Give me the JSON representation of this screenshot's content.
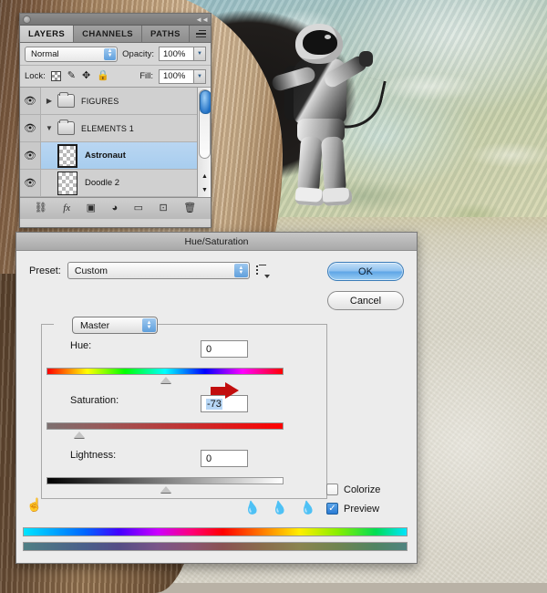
{
  "layers_panel": {
    "title_dot": "collapse-dot",
    "tabs": [
      {
        "label": "LAYERS",
        "active": true
      },
      {
        "label": "CHANNELS",
        "active": false
      },
      {
        "label": "PATHS",
        "active": false
      }
    ],
    "blend_mode": "Normal",
    "opacity_label": "Opacity:",
    "opacity_value": "100%",
    "lock_label": "Lock:",
    "lock_icons": [
      "transparency-lock-icon",
      "paint-lock-icon",
      "move-lock-icon",
      "all-lock-icon"
    ],
    "fill_label": "Fill:",
    "fill_value": "100%",
    "rows": [
      {
        "name": "FIGURES",
        "type": "group",
        "expanded": false,
        "selected": false,
        "visible": true
      },
      {
        "name": "ELEMENTS 1",
        "type": "group",
        "expanded": true,
        "selected": false,
        "visible": true
      },
      {
        "name": "Astronaut",
        "type": "layer",
        "expanded": false,
        "selected": true,
        "visible": true
      },
      {
        "name": "Doodle 2",
        "type": "layer",
        "expanded": false,
        "selected": false,
        "visible": true
      }
    ],
    "bottom_icons": [
      "link-layers-icon",
      "layer-style-fx-icon",
      "add-mask-icon",
      "adjustment-layer-icon",
      "new-group-icon",
      "new-layer-icon",
      "delete-layer-icon"
    ],
    "eye_icon": "eye-icon"
  },
  "dialog": {
    "title": "Hue/Saturation",
    "preset_label": "Preset:",
    "preset_value": "Custom",
    "preset_menu_icon": "preset-options-icon",
    "ok_label": "OK",
    "cancel_label": "Cancel",
    "channel_value": "Master",
    "sliders": [
      {
        "label": "Hue:",
        "value": "0",
        "knob_pct": 50,
        "selected": false
      },
      {
        "label": "Saturation:",
        "value": "-73",
        "knob_pct": 13.5,
        "selected": true
      },
      {
        "label": "Lightness:",
        "value": "0",
        "knob_pct": 50,
        "selected": false
      }
    ],
    "eyedroppers": [
      "eyedropper-icon",
      "eyedropper-add-icon",
      "eyedropper-subtract-icon"
    ],
    "hand_icon": "on-image-adjust-icon",
    "colorize_label": "Colorize",
    "colorize_checked": false,
    "preview_label": "Preview",
    "preview_checked": true,
    "annotation": "red-arrow-pointing-to-saturation-value"
  },
  "artwork": {
    "description": "collage-background"
  },
  "colors": {
    "accent_blue": "#5ea5e6",
    "selection_blue": "#b6d6f5",
    "annotation_red": "#c20d0d",
    "panel_gray": "#d3d3d3",
    "dialog_gray": "#ececec"
  }
}
